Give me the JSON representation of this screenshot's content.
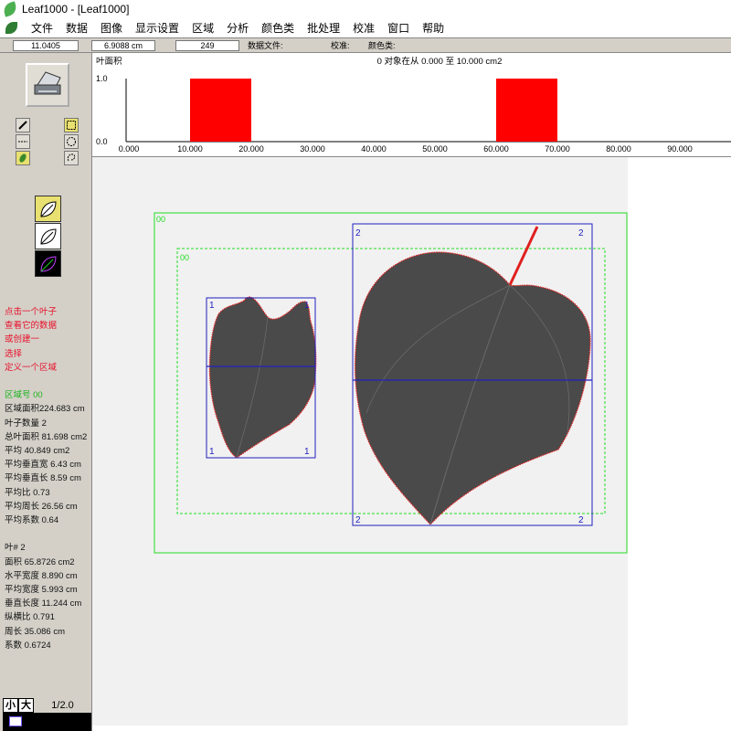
{
  "window": {
    "title": "Leaf1000 - [Leaf1000]"
  },
  "menu": [
    "文件",
    "数据",
    "图像",
    "显示设置",
    "区域",
    "分析",
    "颜色类",
    "批处理",
    "校准",
    "窗口",
    "帮助"
  ],
  "infobar": {
    "field1": "11.0405",
    "field2": "6.9088 cm",
    "field3": "249",
    "data_file_label": "数据文件:",
    "calibration_label": "校准:",
    "color_class_label": "颜色类:"
  },
  "left_panel": {
    "instructions": [
      "点击一个叶子",
      "查看它的数据",
      "或创建一",
      "选择",
      "定义一个区域"
    ],
    "region_title": "区域号 00",
    "region_stats": [
      "区域面积224.683 cm",
      "叶子数量 2",
      "总叶面积 81.698 cm2",
      "平均 40.849 cm2",
      "平均垂直宽 6.43 cm",
      "平均垂直长 8.59 cm",
      "平均比 0.73",
      "平均周长 26.56 cm",
      "平均系数 0.64"
    ],
    "leaf_title": "叶# 2",
    "leaf_stats": [
      "面积 65.8726 cm2",
      "水平宽度 8.890 cm",
      "平均宽度 5.993 cm",
      "垂直长度 11.244 cm",
      "纵横比 0.791",
      "周长 35.086 cm",
      "系数 0.6724"
    ],
    "zoom_small": "小",
    "zoom_large": "大",
    "zoom_value": "1/2.0"
  },
  "histogram": {
    "title_left": "叶面积",
    "title_center": "0 对象在从 0.000 至 10.000 cm2",
    "colors": {
      "bar": "#ff0000"
    }
  },
  "chart_data": {
    "type": "bar",
    "title": "0 对象在从 0.000 至 10.000 cm2",
    "ylabel": "叶面积",
    "ylim": [
      0,
      1
    ],
    "yticks": [
      "0.0",
      "1.0"
    ],
    "xticks": [
      "0.000",
      "10.000",
      "20.000",
      "30.000",
      "40.000",
      "50.000",
      "60.000",
      "70.000",
      "80.000",
      "90.000"
    ],
    "xlim": [
      0,
      100
    ],
    "bars": [
      {
        "x0": 10,
        "x1": 20,
        "value": 1.0
      },
      {
        "x0": 60,
        "x1": 70,
        "value": 1.0
      }
    ]
  },
  "image": {
    "region_label": "00",
    "leaves": [
      {
        "label": "1"
      },
      {
        "label": "2"
      }
    ],
    "colors": {
      "region": "#22dd22",
      "box": "#2020c0",
      "outline": "#e02020",
      "leaf": "#4a4a4a"
    }
  }
}
